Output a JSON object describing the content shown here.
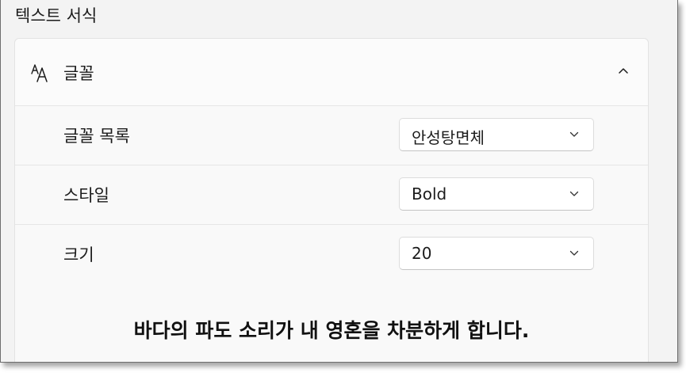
{
  "section": {
    "title": "텍스트 서식"
  },
  "font_group": {
    "label": "글꼴",
    "icon": "font-size-icon",
    "expanded": true
  },
  "settings": {
    "font_list": {
      "label": "글꼴 목록",
      "value": "안성탕면체"
    },
    "style": {
      "label": "스타일",
      "value": "Bold"
    },
    "size": {
      "label": "크기",
      "value": "20"
    }
  },
  "preview": {
    "text": "바다의 파도 소리가 내 영혼을 차분하게 합니다."
  },
  "colors": {
    "background": "#f3f3f3",
    "card": "#f9f9f9",
    "combo": "#ffffff",
    "text": "#1b1b1b"
  }
}
